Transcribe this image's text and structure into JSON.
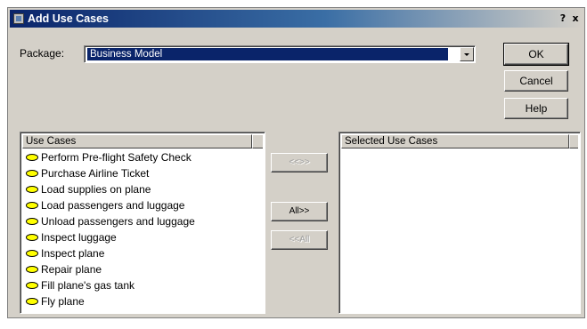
{
  "dialog": {
    "title": "Add Use Cases",
    "help_glyph": "?",
    "close_glyph": "x"
  },
  "package": {
    "label": "Package:",
    "value": "Business Model"
  },
  "buttons": {
    "ok": "OK",
    "cancel": "Cancel",
    "help": "Help",
    "swap": "<<>>",
    "add_all": "All>>",
    "remove_all": "<<All"
  },
  "available": {
    "header": "Use Cases",
    "items": [
      "Perform Pre-flight Safety Check",
      "Purchase Airline Ticket",
      "Load supplies on plane",
      "Load passengers and luggage",
      "Unload passengers and luggage",
      "Inspect luggage",
      "Inspect plane",
      "Repair plane",
      "Fill plane's gas tank",
      "Fly plane"
    ]
  },
  "selected": {
    "header": "Selected Use Cases",
    "items": []
  },
  "colors": {
    "dialog_bg": "#d4d0c8",
    "title_bar": "#0a246a",
    "selection": "#0a246a",
    "use_case_icon": "#ffff00"
  },
  "icons": {
    "use_case": "use-case-ellipse-icon",
    "dropdown": "dropdown-arrow-icon",
    "window": "dialog-icon"
  }
}
